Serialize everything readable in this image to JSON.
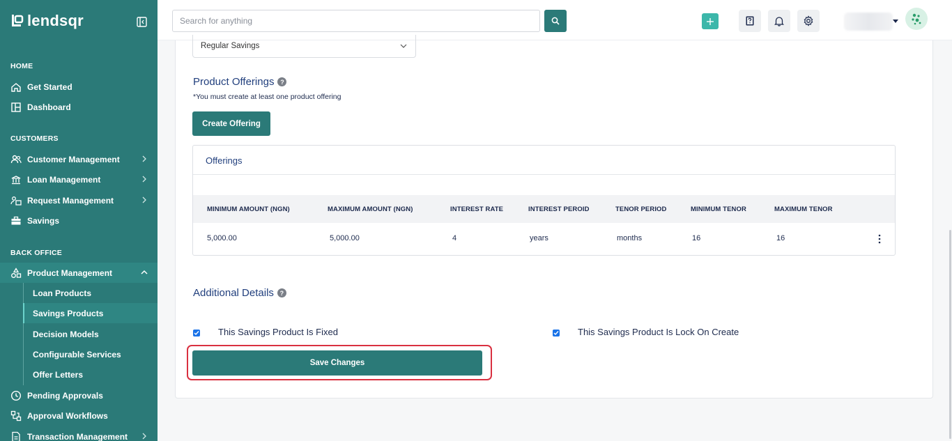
{
  "brand": {
    "name": "lendsqr"
  },
  "sidebar": {
    "sections": {
      "home": "HOME",
      "customers": "CUSTOMERS",
      "back_office": "BACK OFFICE"
    },
    "items": {
      "get_started": "Get Started",
      "dashboard": "Dashboard",
      "customer_management": "Customer Management",
      "loan_management": "Loan Management",
      "request_management": "Request Management",
      "savings": "Savings",
      "product_management": "Product Management",
      "loan_products": "Loan Products",
      "savings_products": "Savings Products",
      "decision_models": "Decision Models",
      "configurable_services": "Configurable Services",
      "offer_letters": "Offer Letters",
      "pending_approvals": "Pending Approvals",
      "approval_workflows": "Approval Workflows",
      "transaction_management": "Transaction Management"
    }
  },
  "header": {
    "search_placeholder": "Search for anything"
  },
  "form": {
    "savings_type_value": "Regular Savings",
    "product_offerings_title": "Product Offerings",
    "product_offerings_note": "*You must create at least one product offering",
    "create_offering_label": "Create Offering",
    "offerings_panel_title": "Offerings",
    "offerings_table": {
      "headers": [
        "MINIMUM AMOUNT (NGN)",
        "MAXIMUM AMOUNT (NGN)",
        "INTEREST RATE",
        "INTEREST PEROID",
        "TENOR PERIOD",
        "MINIMUM TENOR",
        "MAXIMUM TENOR"
      ],
      "rows": [
        [
          "5,000.00",
          "5,000.00",
          "4",
          "years",
          "months",
          "16",
          "16"
        ]
      ]
    },
    "additional_details_title": "Additional Details",
    "checkbox_fixed_label": "This Savings Product Is Fixed",
    "checkbox_fixed_checked": true,
    "checkbox_lock_label": "This Savings Product Is Lock On Create",
    "checkbox_lock_checked": true,
    "save_label": "Save Changes"
  },
  "colors": {
    "sidebar": "#2b7a78",
    "accent": "#39b8aa",
    "highlight_outline": "#d93040",
    "heading": "#213f7d"
  }
}
